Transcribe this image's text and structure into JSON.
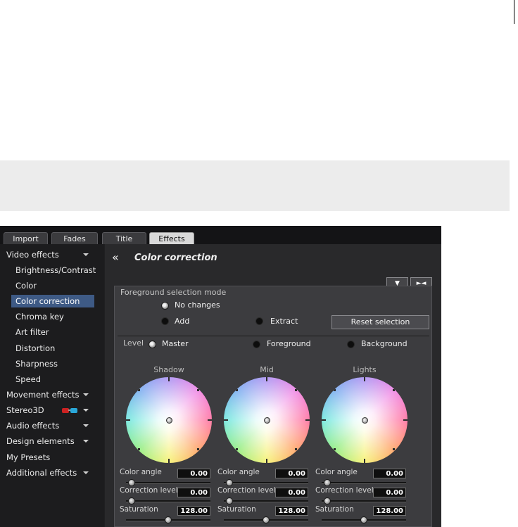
{
  "tabs": [
    {
      "label": "Import",
      "active": false
    },
    {
      "label": "Fades",
      "active": false
    },
    {
      "label": "Title",
      "active": false
    },
    {
      "label": "Effects",
      "active": true
    }
  ],
  "sidebar": {
    "items": [
      {
        "label": "Video effects",
        "level": 0,
        "has_caret": true
      },
      {
        "label": "Brightness/Contrast",
        "level": 1
      },
      {
        "label": "Color",
        "level": 1
      },
      {
        "label": "Color correction",
        "level": 1,
        "selected": true
      },
      {
        "label": "Chroma key",
        "level": 1
      },
      {
        "label": "Art filter",
        "level": 1
      },
      {
        "label": "Distortion",
        "level": 1
      },
      {
        "label": "Sharpness",
        "level": 1
      },
      {
        "label": "Speed",
        "level": 1
      },
      {
        "label": "Movement effects",
        "level": 0,
        "has_caret": true
      },
      {
        "label": "Stereo3D",
        "level": 0,
        "has_caret": true,
        "icon": "3d-glasses-icon"
      },
      {
        "label": "Audio effects",
        "level": 0,
        "has_caret": true
      },
      {
        "label": "Design elements",
        "level": 0,
        "has_caret": true
      },
      {
        "label": "My Presets",
        "level": 0
      },
      {
        "label": "Additional effects",
        "level": 0,
        "has_caret": true
      }
    ]
  },
  "main": {
    "back_icon": "double-chevron-left-icon",
    "title": "Color correction",
    "header_buttons": [
      {
        "icon": "triangle-down-icon",
        "symbol": "▼"
      },
      {
        "icon": "collapse-arrows-icon",
        "symbol": "►◄"
      }
    ]
  },
  "panel": {
    "mode_label": "Foreground selection mode",
    "mode_options": [
      {
        "label": "No changes",
        "selected": true
      },
      {
        "label": "Add",
        "selected": false
      },
      {
        "label": "Extract",
        "selected": false
      }
    ],
    "reset_button": "Reset selection",
    "level_label": "Level",
    "level_options": [
      {
        "label": "Master",
        "selected": true
      },
      {
        "label": "Foreground",
        "selected": false
      },
      {
        "label": "Background",
        "selected": false
      }
    ],
    "wheels": [
      {
        "title": "Shadow",
        "color_angle_label": "Color angle",
        "color_angle": "0.00",
        "correction_level_label": "Correction level",
        "correction_level": "0.00",
        "saturation_label": "Saturation",
        "saturation": "128.00"
      },
      {
        "title": "Mid",
        "color_angle_label": "Color angle",
        "color_angle": "0.00",
        "correction_level_label": "Correction level",
        "correction_level": "0.00",
        "saturation_label": "Saturation",
        "saturation": "128.00"
      },
      {
        "title": "Lights",
        "color_angle_label": "Color angle",
        "color_angle": "0.00",
        "correction_level_label": "Correction level",
        "correction_level": "0.00",
        "saturation_label": "Saturation",
        "saturation": "128.00"
      }
    ]
  },
  "colors": {
    "selection": "#3e5a85",
    "background": "#1f1f21",
    "panel": "#3c3c3f"
  }
}
